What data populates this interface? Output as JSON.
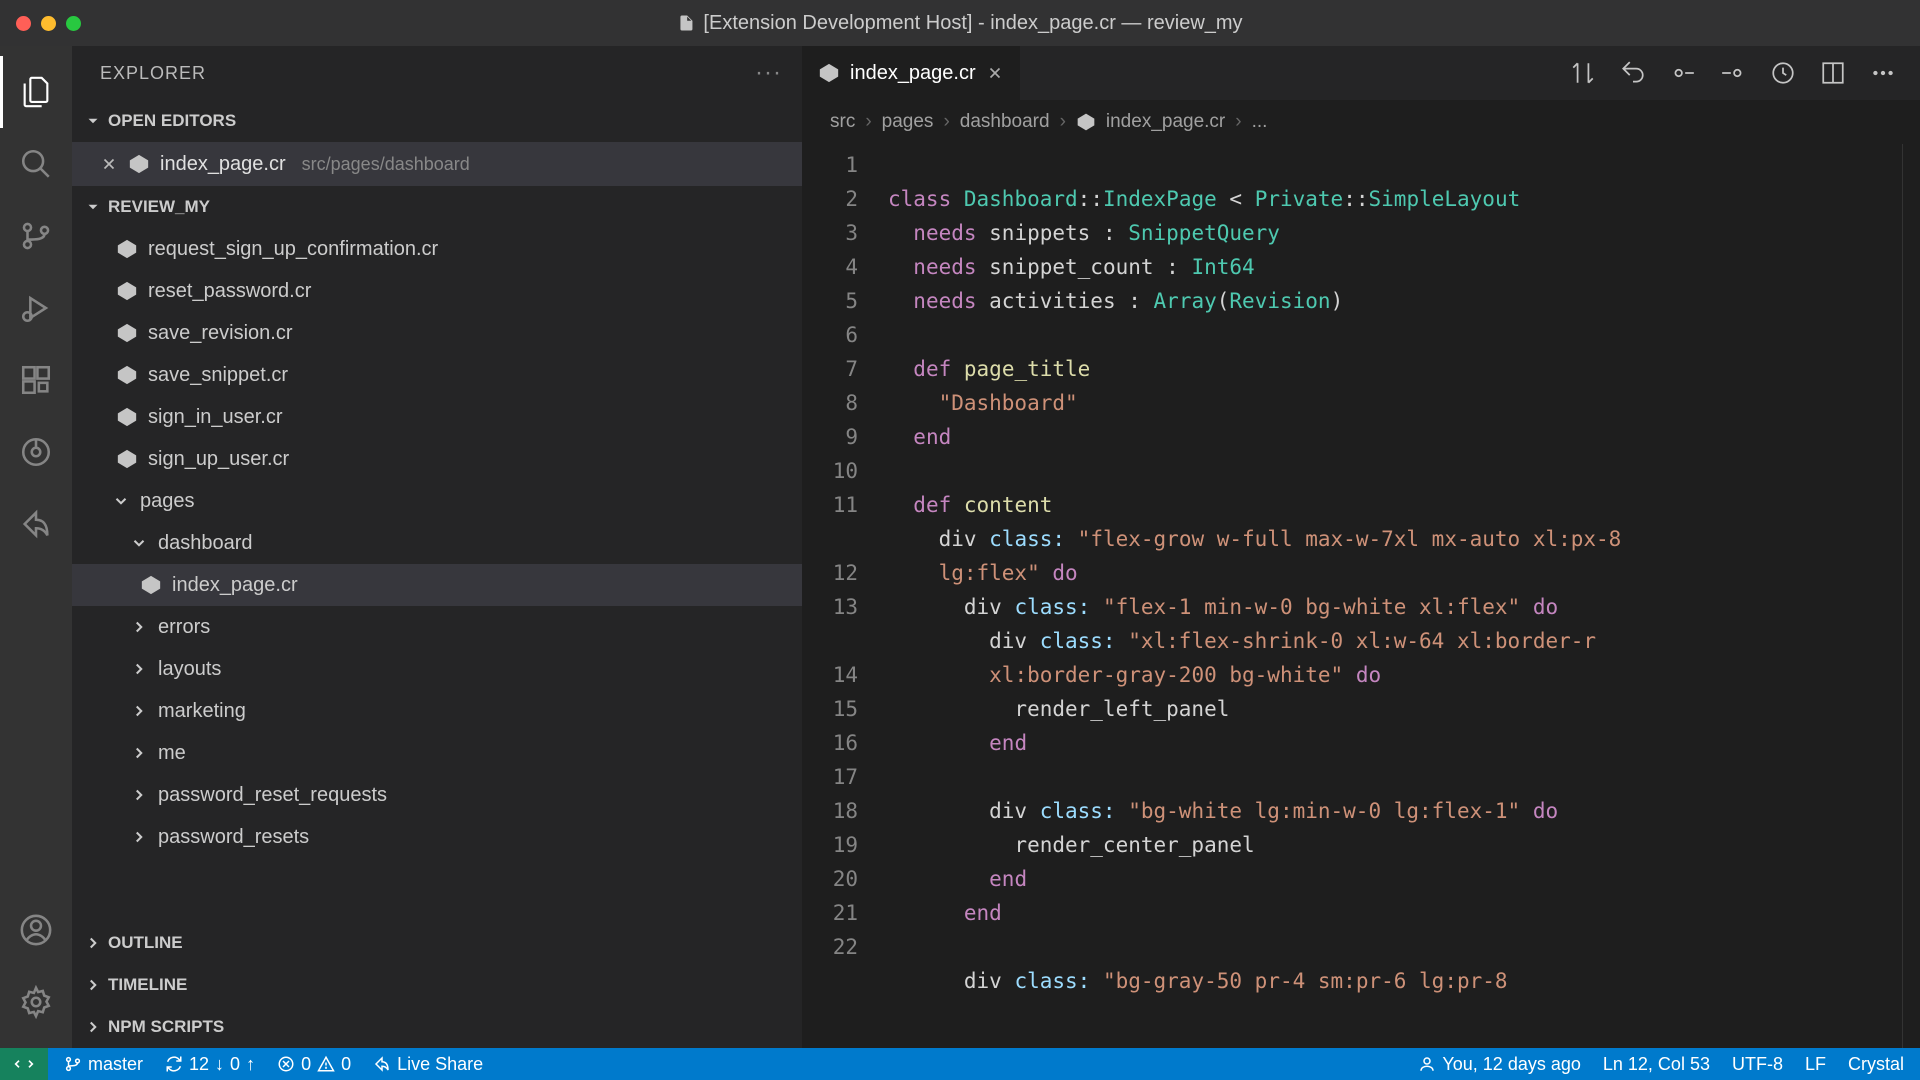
{
  "window": {
    "title": "[Extension Development Host] - index_page.cr — review_my"
  },
  "sidebar": {
    "title": "EXPLORER",
    "sections": {
      "openEditors": "OPEN EDITORS",
      "workspace": "REVIEW_MY",
      "outline": "OUTLINE",
      "timeline": "TIMELINE",
      "npm": "NPM SCRIPTS"
    },
    "openEditor": {
      "name": "index_page.cr",
      "path": "src/pages/dashboard"
    },
    "files": [
      "request_sign_up_confirmation.cr",
      "reset_password.cr",
      "save_revision.cr",
      "save_snippet.cr",
      "sign_in_user.cr",
      "sign_up_user.cr"
    ],
    "folderPages": "pages",
    "folderDashboard": "dashboard",
    "activeFile": "index_page.cr",
    "subfolders": [
      "errors",
      "layouts",
      "marketing",
      "me",
      "password_reset_requests",
      "password_resets"
    ]
  },
  "tab": {
    "name": "index_page.cr"
  },
  "breadcrumb": {
    "parts": [
      "src",
      "pages",
      "dashboard",
      "index_page.cr",
      "..."
    ]
  },
  "code": {
    "lines": [
      1,
      2,
      3,
      4,
      5,
      6,
      7,
      8,
      9,
      10,
      11,
      12,
      13,
      14,
      15,
      16,
      17,
      18,
      19,
      20,
      21,
      22
    ]
  },
  "status": {
    "branch": "master",
    "syncDown": "12",
    "syncUp": "0",
    "errors": "0",
    "warnings": "0",
    "liveShare": "Live Share",
    "blame": "You, 12 days ago",
    "cursor": "Ln 12, Col 53",
    "encoding": "UTF-8",
    "eol": "LF",
    "lang": "Crystal"
  }
}
